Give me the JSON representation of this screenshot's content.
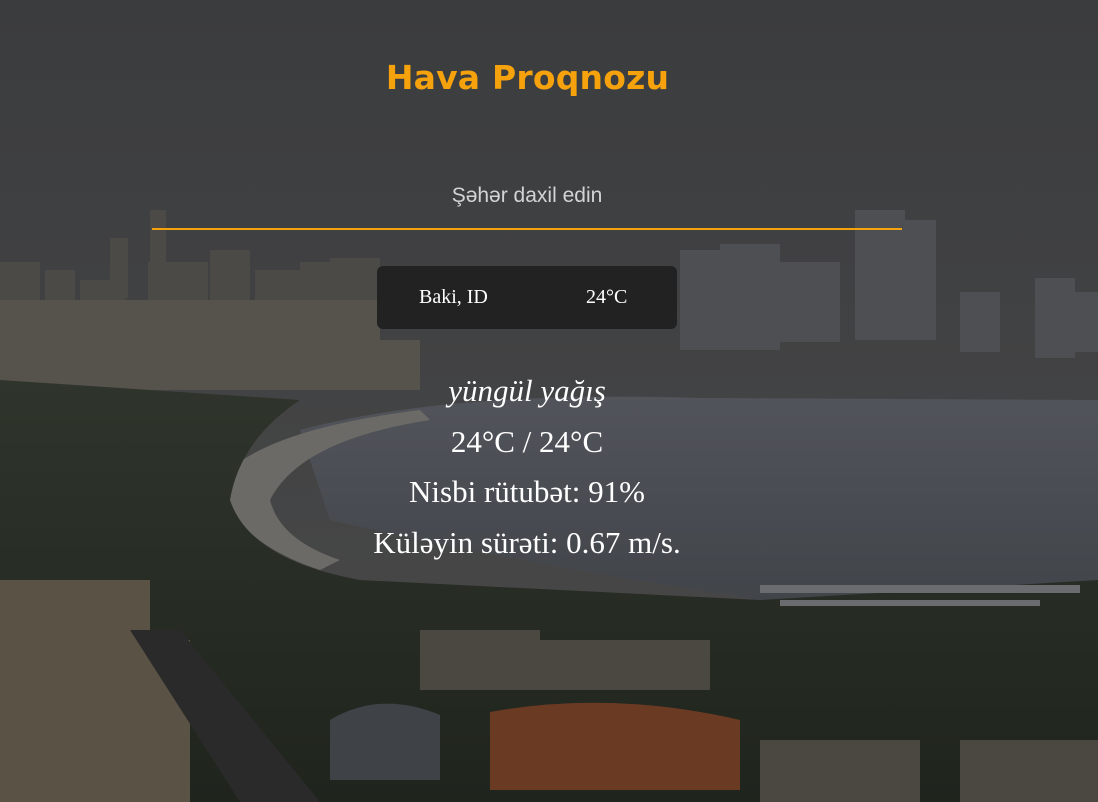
{
  "app": {
    "title": "Hava Proqnozu"
  },
  "search": {
    "placeholder": "Şəhər daxil edin",
    "value": ""
  },
  "result": {
    "city": "Baki, ID",
    "temperature": "24°C"
  },
  "details": {
    "description": "yüngül yağış",
    "temp_range": "24°C / 24°C",
    "humidity": "Nisbi rütubət: 91%",
    "wind": "Küləyin sürəti: 0.67 m/s."
  },
  "colors": {
    "accent": "#f5a20c",
    "card_bg": "#222223",
    "text": "#ffffff"
  },
  "background": {
    "icon": "city-skyline-photo"
  }
}
